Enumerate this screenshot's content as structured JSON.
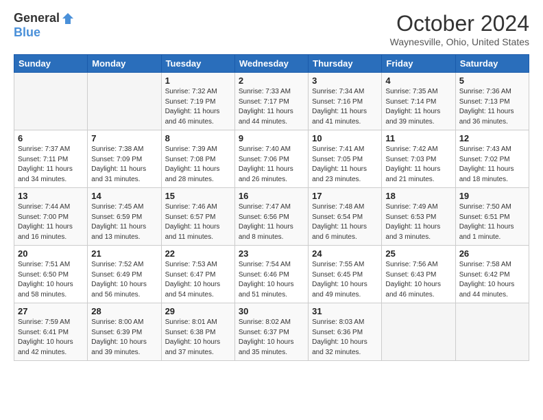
{
  "logo": {
    "general": "General",
    "blue": "Blue"
  },
  "title": "October 2024",
  "location": "Waynesville, Ohio, United States",
  "days_of_week": [
    "Sunday",
    "Monday",
    "Tuesday",
    "Wednesday",
    "Thursday",
    "Friday",
    "Saturday"
  ],
  "weeks": [
    [
      {
        "day": "",
        "sunrise": "",
        "sunset": "",
        "daylight": ""
      },
      {
        "day": "",
        "sunrise": "",
        "sunset": "",
        "daylight": ""
      },
      {
        "day": "1",
        "sunrise": "Sunrise: 7:32 AM",
        "sunset": "Sunset: 7:19 PM",
        "daylight": "Daylight: 11 hours and 46 minutes."
      },
      {
        "day": "2",
        "sunrise": "Sunrise: 7:33 AM",
        "sunset": "Sunset: 7:17 PM",
        "daylight": "Daylight: 11 hours and 44 minutes."
      },
      {
        "day": "3",
        "sunrise": "Sunrise: 7:34 AM",
        "sunset": "Sunset: 7:16 PM",
        "daylight": "Daylight: 11 hours and 41 minutes."
      },
      {
        "day": "4",
        "sunrise": "Sunrise: 7:35 AM",
        "sunset": "Sunset: 7:14 PM",
        "daylight": "Daylight: 11 hours and 39 minutes."
      },
      {
        "day": "5",
        "sunrise": "Sunrise: 7:36 AM",
        "sunset": "Sunset: 7:13 PM",
        "daylight": "Daylight: 11 hours and 36 minutes."
      }
    ],
    [
      {
        "day": "6",
        "sunrise": "Sunrise: 7:37 AM",
        "sunset": "Sunset: 7:11 PM",
        "daylight": "Daylight: 11 hours and 34 minutes."
      },
      {
        "day": "7",
        "sunrise": "Sunrise: 7:38 AM",
        "sunset": "Sunset: 7:09 PM",
        "daylight": "Daylight: 11 hours and 31 minutes."
      },
      {
        "day": "8",
        "sunrise": "Sunrise: 7:39 AM",
        "sunset": "Sunset: 7:08 PM",
        "daylight": "Daylight: 11 hours and 28 minutes."
      },
      {
        "day": "9",
        "sunrise": "Sunrise: 7:40 AM",
        "sunset": "Sunset: 7:06 PM",
        "daylight": "Daylight: 11 hours and 26 minutes."
      },
      {
        "day": "10",
        "sunrise": "Sunrise: 7:41 AM",
        "sunset": "Sunset: 7:05 PM",
        "daylight": "Daylight: 11 hours and 23 minutes."
      },
      {
        "day": "11",
        "sunrise": "Sunrise: 7:42 AM",
        "sunset": "Sunset: 7:03 PM",
        "daylight": "Daylight: 11 hours and 21 minutes."
      },
      {
        "day": "12",
        "sunrise": "Sunrise: 7:43 AM",
        "sunset": "Sunset: 7:02 PM",
        "daylight": "Daylight: 11 hours and 18 minutes."
      }
    ],
    [
      {
        "day": "13",
        "sunrise": "Sunrise: 7:44 AM",
        "sunset": "Sunset: 7:00 PM",
        "daylight": "Daylight: 11 hours and 16 minutes."
      },
      {
        "day": "14",
        "sunrise": "Sunrise: 7:45 AM",
        "sunset": "Sunset: 6:59 PM",
        "daylight": "Daylight: 11 hours and 13 minutes."
      },
      {
        "day": "15",
        "sunrise": "Sunrise: 7:46 AM",
        "sunset": "Sunset: 6:57 PM",
        "daylight": "Daylight: 11 hours and 11 minutes."
      },
      {
        "day": "16",
        "sunrise": "Sunrise: 7:47 AM",
        "sunset": "Sunset: 6:56 PM",
        "daylight": "Daylight: 11 hours and 8 minutes."
      },
      {
        "day": "17",
        "sunrise": "Sunrise: 7:48 AM",
        "sunset": "Sunset: 6:54 PM",
        "daylight": "Daylight: 11 hours and 6 minutes."
      },
      {
        "day": "18",
        "sunrise": "Sunrise: 7:49 AM",
        "sunset": "Sunset: 6:53 PM",
        "daylight": "Daylight: 11 hours and 3 minutes."
      },
      {
        "day": "19",
        "sunrise": "Sunrise: 7:50 AM",
        "sunset": "Sunset: 6:51 PM",
        "daylight": "Daylight: 11 hours and 1 minute."
      }
    ],
    [
      {
        "day": "20",
        "sunrise": "Sunrise: 7:51 AM",
        "sunset": "Sunset: 6:50 PM",
        "daylight": "Daylight: 10 hours and 58 minutes."
      },
      {
        "day": "21",
        "sunrise": "Sunrise: 7:52 AM",
        "sunset": "Sunset: 6:49 PM",
        "daylight": "Daylight: 10 hours and 56 minutes."
      },
      {
        "day": "22",
        "sunrise": "Sunrise: 7:53 AM",
        "sunset": "Sunset: 6:47 PM",
        "daylight": "Daylight: 10 hours and 54 minutes."
      },
      {
        "day": "23",
        "sunrise": "Sunrise: 7:54 AM",
        "sunset": "Sunset: 6:46 PM",
        "daylight": "Daylight: 10 hours and 51 minutes."
      },
      {
        "day": "24",
        "sunrise": "Sunrise: 7:55 AM",
        "sunset": "Sunset: 6:45 PM",
        "daylight": "Daylight: 10 hours and 49 minutes."
      },
      {
        "day": "25",
        "sunrise": "Sunrise: 7:56 AM",
        "sunset": "Sunset: 6:43 PM",
        "daylight": "Daylight: 10 hours and 46 minutes."
      },
      {
        "day": "26",
        "sunrise": "Sunrise: 7:58 AM",
        "sunset": "Sunset: 6:42 PM",
        "daylight": "Daylight: 10 hours and 44 minutes."
      }
    ],
    [
      {
        "day": "27",
        "sunrise": "Sunrise: 7:59 AM",
        "sunset": "Sunset: 6:41 PM",
        "daylight": "Daylight: 10 hours and 42 minutes."
      },
      {
        "day": "28",
        "sunrise": "Sunrise: 8:00 AM",
        "sunset": "Sunset: 6:39 PM",
        "daylight": "Daylight: 10 hours and 39 minutes."
      },
      {
        "day": "29",
        "sunrise": "Sunrise: 8:01 AM",
        "sunset": "Sunset: 6:38 PM",
        "daylight": "Daylight: 10 hours and 37 minutes."
      },
      {
        "day": "30",
        "sunrise": "Sunrise: 8:02 AM",
        "sunset": "Sunset: 6:37 PM",
        "daylight": "Daylight: 10 hours and 35 minutes."
      },
      {
        "day": "31",
        "sunrise": "Sunrise: 8:03 AM",
        "sunset": "Sunset: 6:36 PM",
        "daylight": "Daylight: 10 hours and 32 minutes."
      },
      {
        "day": "",
        "sunrise": "",
        "sunset": "",
        "daylight": ""
      },
      {
        "day": "",
        "sunrise": "",
        "sunset": "",
        "daylight": ""
      }
    ]
  ]
}
